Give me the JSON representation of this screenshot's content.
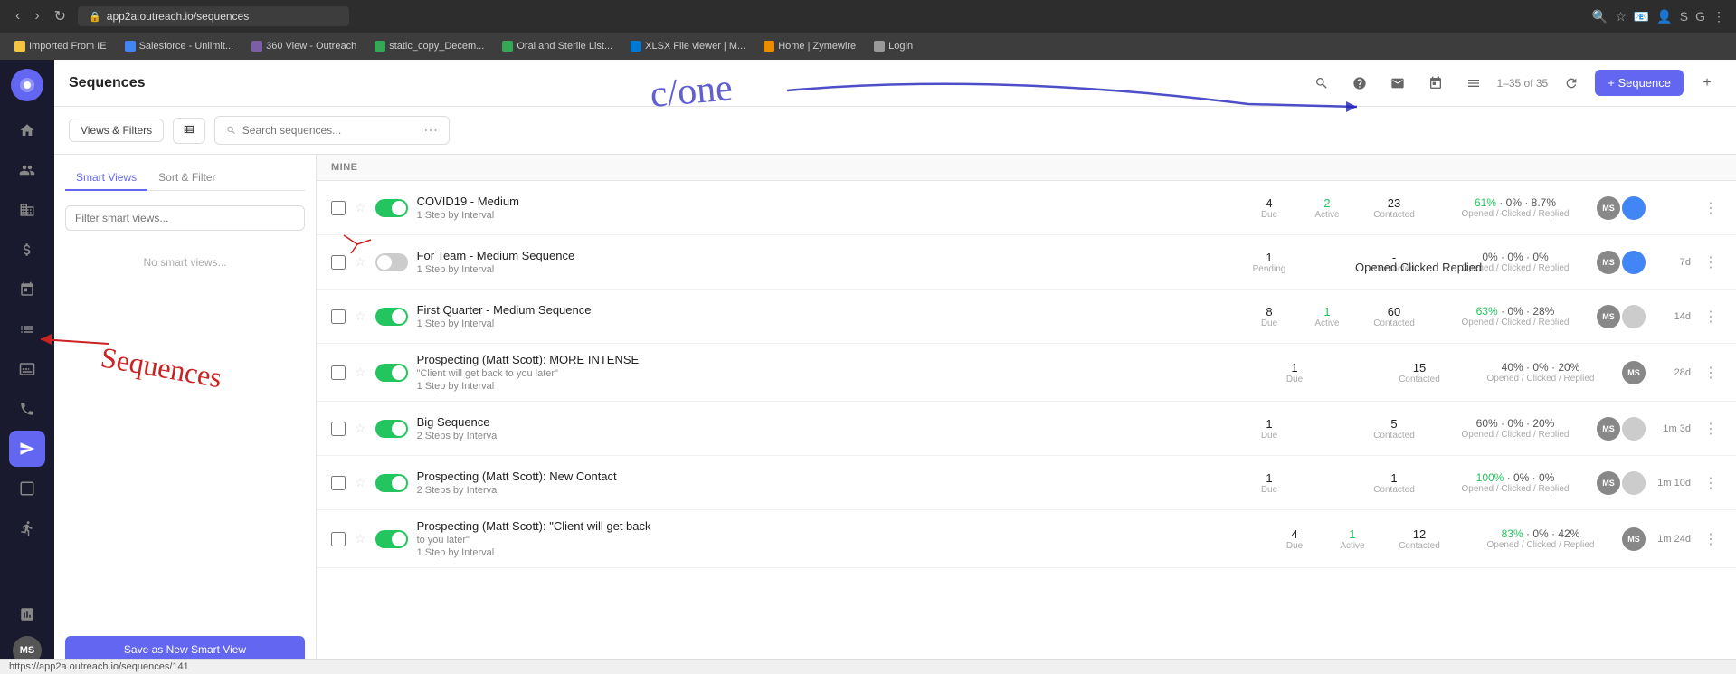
{
  "browser": {
    "url": "app2a.outreach.io/sequences",
    "bookmarks": [
      {
        "label": "Imported From IE",
        "color": "bk-yellow"
      },
      {
        "label": "Salesforce - Unlimit...",
        "color": "bk-blue"
      },
      {
        "label": "360 View - Outreach",
        "color": "bk-purple"
      },
      {
        "label": "static_copy_Decem...",
        "color": "bk-green"
      },
      {
        "label": "Oral and Sterile List...",
        "color": "bk-green"
      },
      {
        "label": "XLSX File viewer | M...",
        "color": "bk-teal"
      },
      {
        "label": "Home | Zymewire",
        "color": "bk-orange"
      },
      {
        "label": "Login",
        "color": "bk-gray"
      }
    ]
  },
  "sidebar": {
    "items": [
      {
        "name": "home",
        "icon": "⌂"
      },
      {
        "name": "contacts",
        "icon": "👥"
      },
      {
        "name": "accounts",
        "icon": "🏢"
      },
      {
        "name": "deals",
        "icon": "💲"
      },
      {
        "name": "calendar",
        "icon": "📅"
      },
      {
        "name": "tasks",
        "icon": "☰"
      },
      {
        "name": "reports",
        "icon": "📊"
      },
      {
        "name": "phone",
        "icon": "📞"
      },
      {
        "name": "sequences",
        "icon": "✈",
        "active": true
      },
      {
        "name": "templates",
        "icon": "⬜"
      },
      {
        "name": "snippets",
        "icon": "✂"
      },
      {
        "name": "analytics",
        "icon": "📈"
      }
    ],
    "user_initials": "MS"
  },
  "header": {
    "title": "Sequences",
    "new_sequence_label": "+ Sequence",
    "pagination": "1–35 of 35"
  },
  "filters": {
    "views_filters_label": "Views & Filters",
    "search_placeholder": "Search sequences...",
    "mine_label": "MINE"
  },
  "smart_views": {
    "tab_smart_views": "Smart Views",
    "tab_sort_filter": "Sort & Filter",
    "filter_placeholder": "Filter smart views...",
    "no_views_text": "No smart views...",
    "save_label": "Save as New Smart View"
  },
  "sequences": [
    {
      "id": 1,
      "name": "COVID19 - Medium",
      "sub": "1 Step by Interval",
      "enabled": true,
      "due": 4,
      "active": 2,
      "contacted": 23,
      "opened": "61%",
      "clicked": "0%",
      "replied": "8.7%",
      "time": "",
      "avatars": [
        "MS",
        ""
      ]
    },
    {
      "id": 2,
      "name": "For Team - Medium Sequence",
      "sub": "1 Step by Interval",
      "enabled": false,
      "due": 1,
      "status": "Pending",
      "contacted": "-",
      "opened": "0%",
      "clicked": "0%",
      "replied": "0%",
      "time": "7d",
      "avatars": [
        "MS",
        ""
      ]
    },
    {
      "id": 3,
      "name": "First Quarter - Medium Sequence",
      "sub": "1 Step by Interval",
      "enabled": true,
      "due": 8,
      "active": 1,
      "contacted": 60,
      "opened": "63%",
      "clicked": "0%",
      "replied": "28%",
      "time": "14d",
      "avatars": [
        "MS",
        ""
      ]
    },
    {
      "id": 4,
      "name": "Prospecting (Matt Scott): MORE INTENSE \"Client will get back to you later\"",
      "sub": "1 Step by Interval",
      "enabled": true,
      "due": 1,
      "active": null,
      "contacted": 15,
      "opened": "40%",
      "clicked": "0%",
      "replied": "20%",
      "time": "28d",
      "avatars": [
        "MS"
      ]
    },
    {
      "id": 5,
      "name": "Big Sequence",
      "sub": "2 Steps by Interval",
      "enabled": true,
      "due": 1,
      "active": null,
      "contacted": 5,
      "opened": "60%",
      "clicked": "0%",
      "replied": "20%",
      "time": "1m 3d",
      "avatars": [
        "MS",
        ""
      ]
    },
    {
      "id": 6,
      "name": "Prospecting (Matt Scott): New Contact",
      "sub": "2 Steps by Interval",
      "enabled": true,
      "due": 1,
      "active": null,
      "contacted": 1,
      "opened": "100%",
      "clicked": "0%",
      "replied": "0%",
      "time": "1m 10d",
      "avatars": [
        "MS",
        ""
      ]
    },
    {
      "id": 7,
      "name": "Prospecting (Matt Scott): \"Client will get back to you later\"",
      "sub": "1 Step by Interval",
      "enabled": true,
      "due": 4,
      "active": 1,
      "contacted": 12,
      "opened": "83%",
      "clicked": "0%",
      "replied": "42%",
      "time": "1m 24d",
      "avatars": [
        "MS"
      ]
    }
  ],
  "status_labels": {
    "due": "Due",
    "active": "Active",
    "pending": "Pending",
    "contacted": "Contacted",
    "opened_clicked_replied": "Opened / Clicked / Replied"
  }
}
